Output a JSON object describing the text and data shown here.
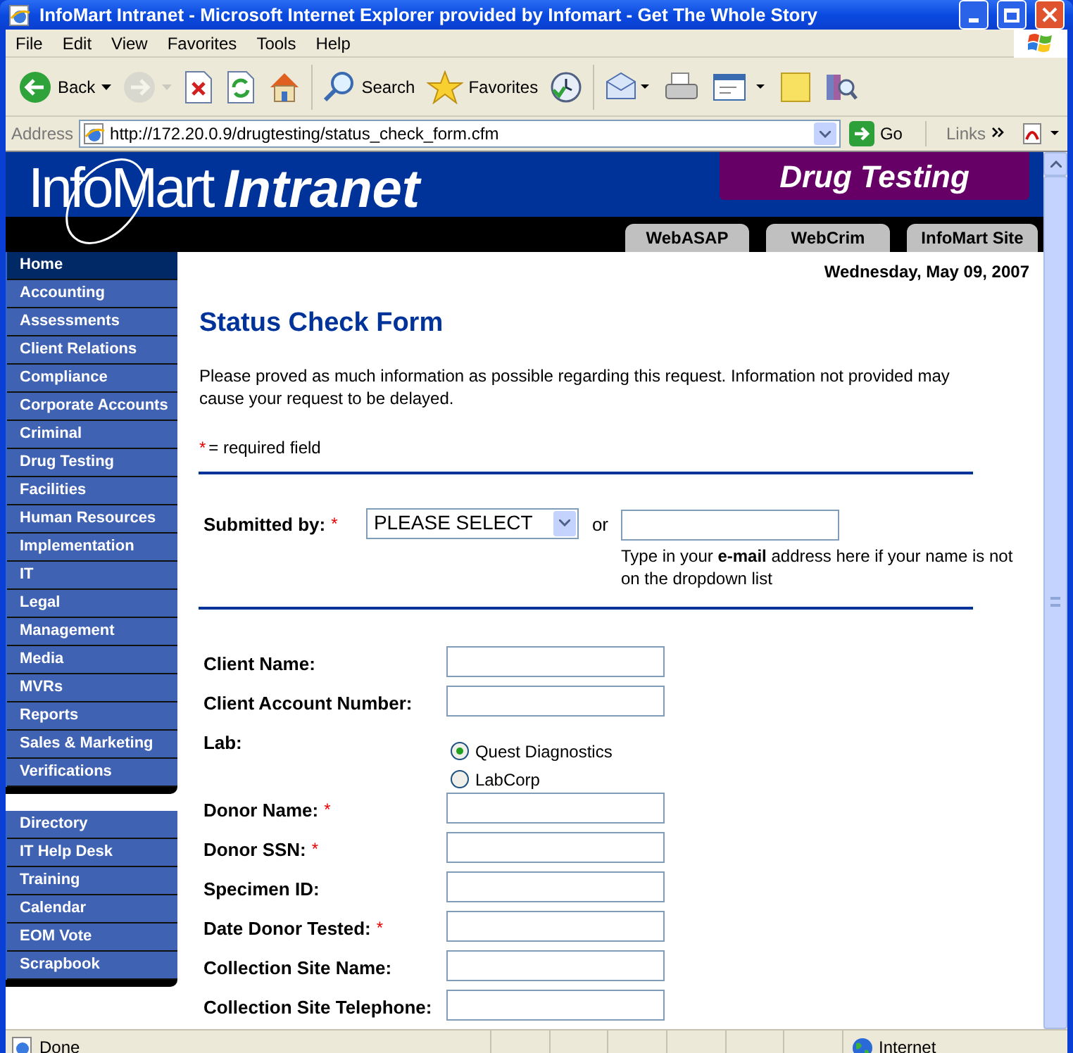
{
  "window": {
    "title": "InfoMart Intranet - Microsoft Internet Explorer provided by Infomart - Get The Whole Story"
  },
  "menu_bar": [
    "File",
    "Edit",
    "View",
    "Favorites",
    "Tools",
    "Help"
  ],
  "toolbar": [
    {
      "kind": "back",
      "label": "Back",
      "disabled": false
    },
    {
      "kind": "forward",
      "disabled": true
    },
    {
      "kind": "stop",
      "disabled": false
    },
    {
      "kind": "refresh",
      "disabled": false
    },
    {
      "kind": "home",
      "disabled": false
    },
    {
      "kind": "search",
      "label": "Search",
      "disabled": false
    },
    {
      "kind": "favorites",
      "label": "Favorites",
      "disabled": false
    },
    {
      "kind": "history",
      "disabled": false
    },
    {
      "kind": "mail",
      "disabled": false
    },
    {
      "kind": "print",
      "disabled": false
    },
    {
      "kind": "edit",
      "disabled": false
    },
    {
      "kind": "note",
      "disabled": false
    },
    {
      "kind": "research",
      "disabled": false
    }
  ],
  "address_bar": {
    "label": "Address",
    "url": "http://172.20.0.9/drugtesting/status_check_form.cfm",
    "go": "Go",
    "links": "Links"
  },
  "banner": {
    "logo": "InfoMart",
    "logo_suffix": "Intranet",
    "section": "Drug Testing",
    "tabs": [
      "WebASAP",
      "WebCrim",
      "InfoMart Site"
    ]
  },
  "sidebar": {
    "groups": [
      {
        "items": [
          {
            "label": "Home",
            "selected": true
          },
          {
            "label": "Accounting",
            "selected": false
          },
          {
            "label": "Assessments",
            "selected": false
          },
          {
            "label": "Client Relations",
            "selected": false
          },
          {
            "label": "Compliance",
            "selected": false
          },
          {
            "label": "Corporate Accounts",
            "selected": false
          },
          {
            "label": "Criminal",
            "selected": false
          },
          {
            "label": "Drug Testing",
            "selected": false
          },
          {
            "label": "Facilities",
            "selected": false
          },
          {
            "label": "Human Resources",
            "selected": false
          },
          {
            "label": "Implementation",
            "selected": false
          },
          {
            "label": "IT",
            "selected": false
          },
          {
            "label": "Legal",
            "selected": false
          },
          {
            "label": "Management",
            "selected": false
          },
          {
            "label": "Media",
            "selected": false
          },
          {
            "label": "MVRs",
            "selected": false
          },
          {
            "label": "Reports",
            "selected": false
          },
          {
            "label": "Sales & Marketing",
            "selected": false
          },
          {
            "label": "Verifications",
            "selected": false
          }
        ]
      },
      {
        "items": [
          {
            "label": "Directory",
            "selected": false
          },
          {
            "label": "IT Help Desk",
            "selected": false
          },
          {
            "label": "Training",
            "selected": false
          },
          {
            "label": "Calendar",
            "selected": false
          },
          {
            "label": "EOM Vote",
            "selected": false
          },
          {
            "label": "Scrapbook",
            "selected": false
          }
        ]
      }
    ]
  },
  "date": "Wednesday, May 09, 2007",
  "form": {
    "title": "Status Check Form",
    "intro": "Please proved as much information as possible regarding this request. Information not provided may cause your request to be delayed.",
    "required_mark": "*",
    "required_note": "= required field",
    "submitted_by": {
      "label": "Submitted by:",
      "required": true,
      "select_value": "PLEASE SELECT",
      "or": "or",
      "email_hint": "Type in your **e-mail** address here if your name is not on the dropdown list"
    },
    "fields": [
      {
        "kind": "text",
        "label": "Client Name:",
        "required": false
      },
      {
        "kind": "text",
        "label": "Client Account Number:",
        "required": false
      },
      {
        "kind": "radio",
        "label": "Lab:",
        "required": false,
        "options": [
          {
            "label": "Quest Diagnostics",
            "selected": true
          },
          {
            "label": "LabCorp",
            "selected": false
          }
        ]
      },
      {
        "kind": "text",
        "label": "Donor Name:",
        "required": true
      },
      {
        "kind": "text",
        "label": "Donor SSN:",
        "required": true
      },
      {
        "kind": "text",
        "label": "Specimen ID:",
        "required": false
      },
      {
        "kind": "text",
        "label": "Date Donor Tested:",
        "required": true
      },
      {
        "kind": "text",
        "label": "Collection Site Name:",
        "required": false
      },
      {
        "kind": "text",
        "label": "Collection Site Telephone:",
        "required": false
      }
    ]
  },
  "status_bar": {
    "text": "Done",
    "zone": "Internet"
  }
}
